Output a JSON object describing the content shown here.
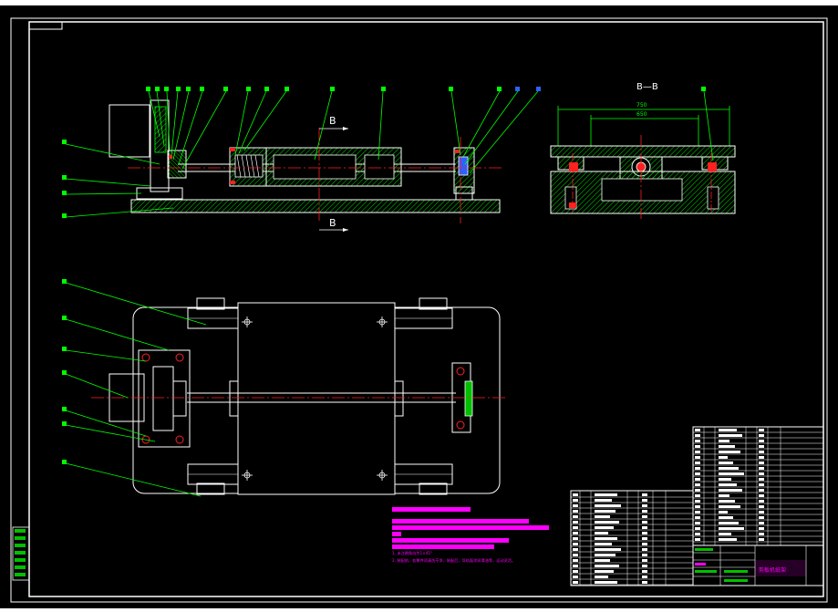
{
  "colors": {
    "background": "#000000",
    "lines": "#ffffff",
    "leaders": "#00ff00",
    "hatch": "#00c000",
    "centerline": "#ff2020",
    "highlight": "#ff00ff",
    "dimension": "#00ff00",
    "callouts_blue": "#3060ff",
    "section_text": "#ffffff"
  },
  "labels": {
    "section_cut": "B",
    "section_title": "B—B",
    "dim_outer": "750",
    "dim_inner": "650",
    "tech_req_1": "1. 未注倒角均为1×45°",
    "tech_req_2": "2. 装配前，各零件须清洗干净，装配后，导轨面涂润滑油等，运动灵活。",
    "title_block_name": "剪板机纸架"
  },
  "icons": {
    "section_arrow": "arrow-right-icon",
    "center_mark": "crosshair-icon"
  }
}
